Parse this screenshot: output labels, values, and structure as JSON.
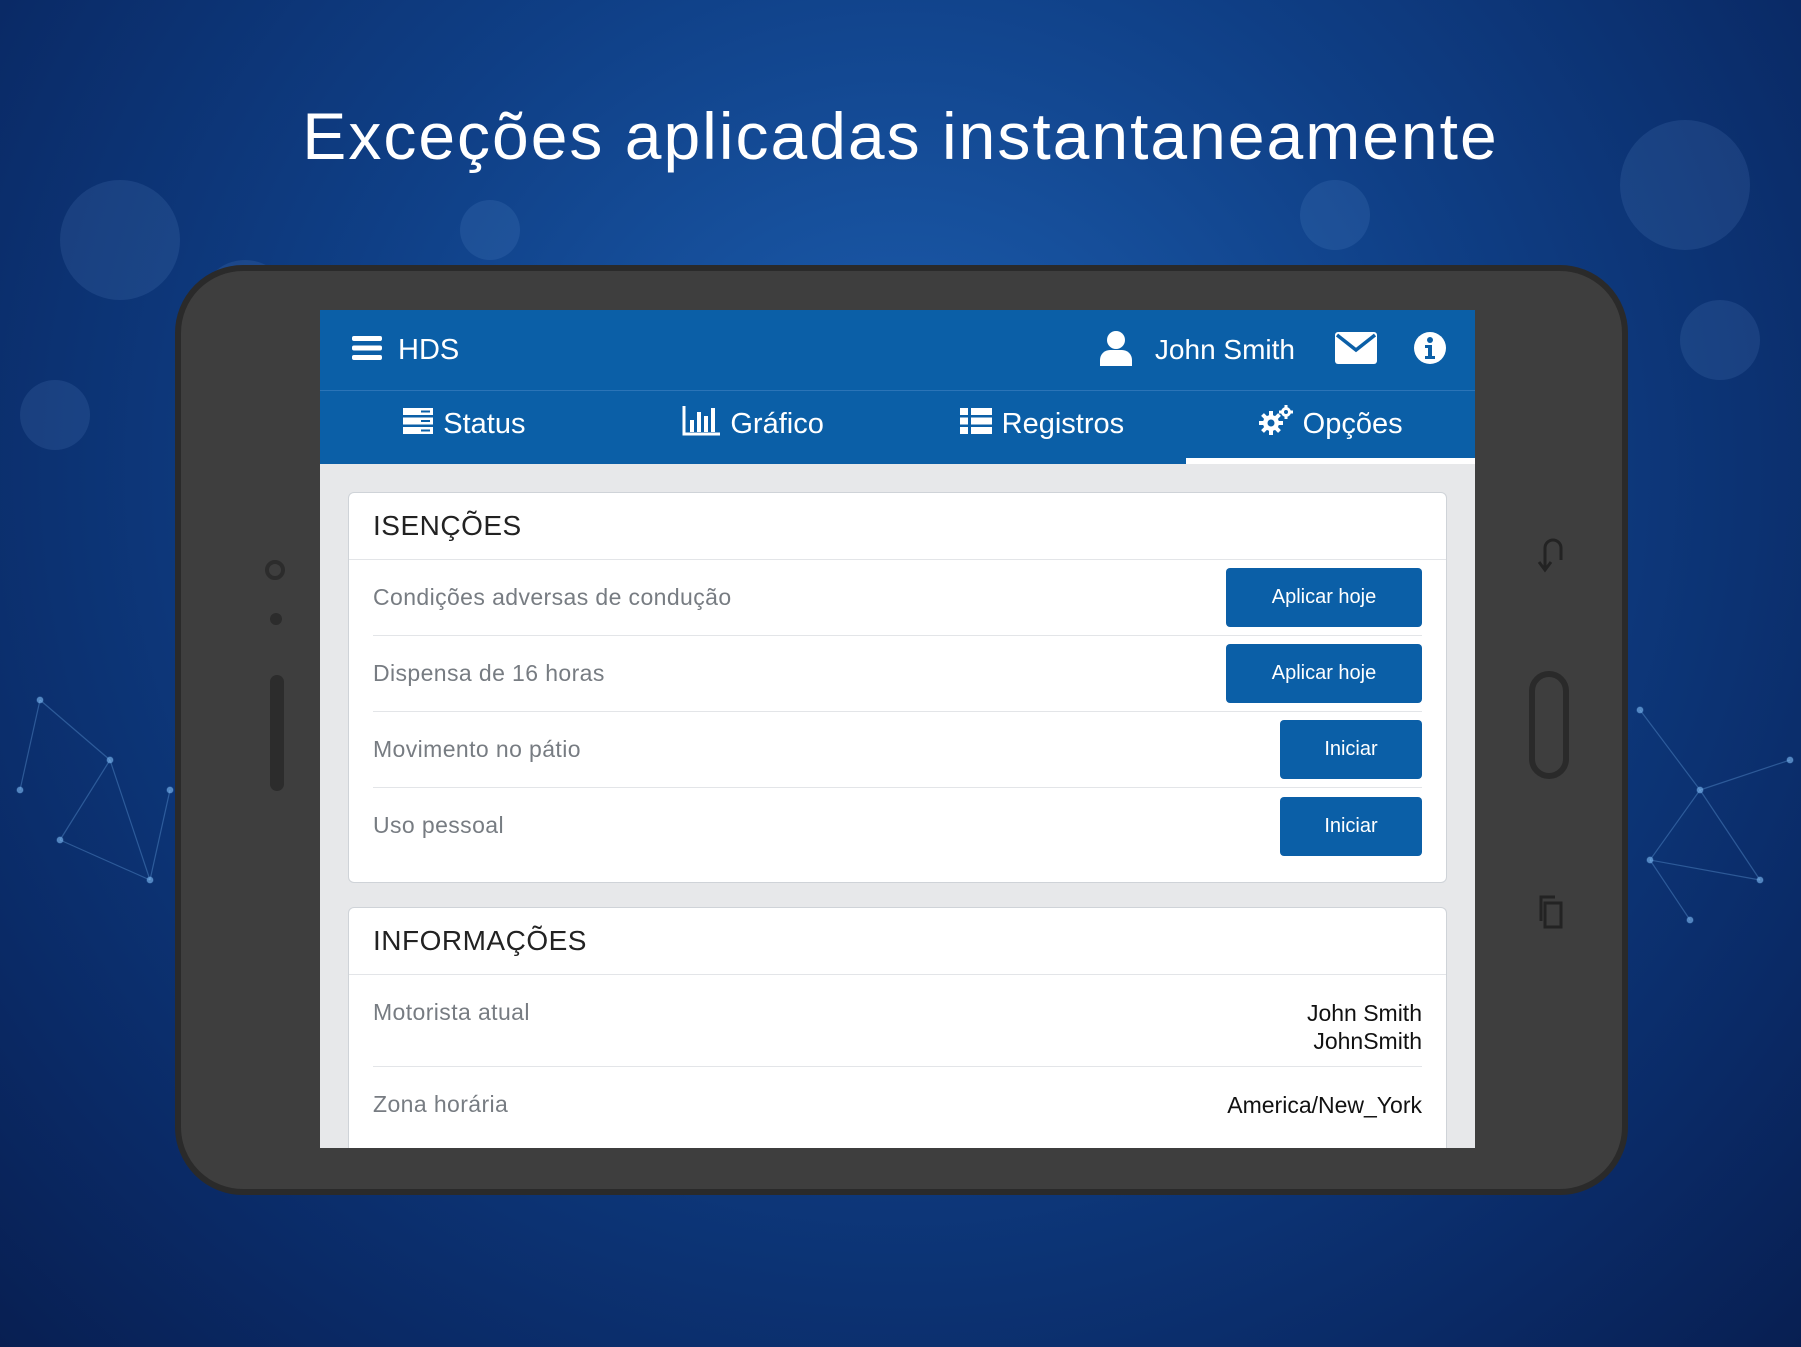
{
  "headline": "Exceções aplicadas instantaneamente",
  "appbar": {
    "menu_icon": "hamburger-icon",
    "title": "HDS",
    "user_icon": "user-icon",
    "user_name": "John Smith",
    "mail_icon": "envelope-icon",
    "info_icon": "info-icon"
  },
  "tabs": [
    {
      "label": "Status",
      "icon": "server-list-icon",
      "active": false
    },
    {
      "label": "Gráfico",
      "icon": "bar-chart-icon",
      "active": false
    },
    {
      "label": "Registros",
      "icon": "list-icon",
      "active": false
    },
    {
      "label": "Opções",
      "icon": "gears-icon",
      "active": true
    }
  ],
  "exemptions": {
    "heading": "ISENÇÕES",
    "items": [
      {
        "label": "Condições adversas de condução",
        "button": "Aplicar hoje"
      },
      {
        "label": "Dispensa de 16 horas",
        "button": "Aplicar hoje"
      },
      {
        "label": "Movimento no pátio",
        "button": "Iniciar"
      },
      {
        "label": "Uso pessoal",
        "button": "Iniciar"
      }
    ]
  },
  "information": {
    "heading": "INFORMAÇÕES",
    "current_driver_label": "Motorista atual",
    "current_driver_name": "John Smith",
    "current_driver_id": "JohnSmith",
    "timezone_label": "Zona horária",
    "timezone_value": "America/New_York"
  },
  "colors": {
    "primary": "#0b5fa7",
    "background": "#0f3f86",
    "device_body": "#3e3e3e"
  }
}
